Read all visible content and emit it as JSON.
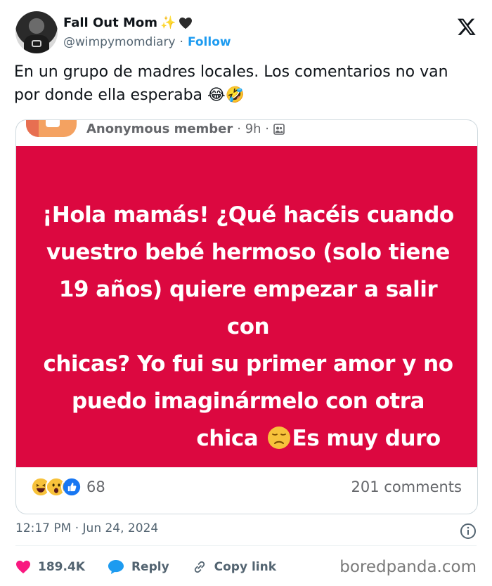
{
  "author": {
    "display_name": "Fall Out Mom",
    "name_emojis": [
      "sparkles-icon",
      "black-heart-icon"
    ],
    "handle": "@wimpymomdiary",
    "separator": "·",
    "follow_label": "Follow"
  },
  "tweet": {
    "text": "En un grupo de madres locales. Los comentarios no van por donde ella esperaba 😂🤣"
  },
  "embedded_post": {
    "author": "Anonymous member",
    "meta": "· 9h ·",
    "members_icon": "group-members-icon",
    "background_color": "#dc0840",
    "lines": [
      "¡Hola mamás! ¿Qué hacéis cuando",
      "vuestro bebé hermoso (solo tiene",
      "19 años) quiere empezar a salir con",
      "chicas? Yo fui su primer amor y no",
      "puedo imaginármelo con otra"
    ],
    "last_line_before": "chica",
    "last_line_after": "Es muy duro",
    "reactions": [
      "laughing-reaction-icon",
      "wow-reaction-icon",
      "like-reaction-icon"
    ],
    "reaction_count": "68",
    "comments": "201 comments"
  },
  "timestamp": "12:17 PM · Jun 24, 2024",
  "actions": {
    "likes": "189.4K",
    "reply": "Reply",
    "copy_link": "Copy link"
  },
  "watermark": "boredpanda.com",
  "colors": {
    "accent": "#1d9bf0",
    "like": "#f91880",
    "panel": "#dc0840"
  }
}
